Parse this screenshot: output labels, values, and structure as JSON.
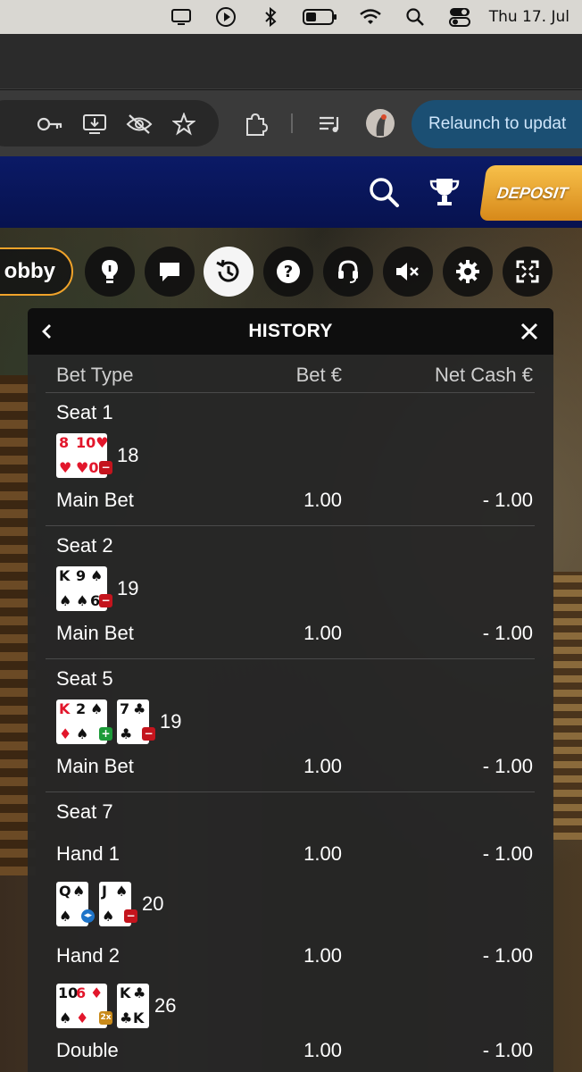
{
  "menubar": {
    "clock": "Thu 17. Jul",
    "icons": [
      "display-icon",
      "play-circle-icon",
      "bluetooth-icon",
      "battery-icon",
      "wifi-icon",
      "spotlight-search-icon",
      "control-center-icon"
    ]
  },
  "browser": {
    "toolbar_icons": [
      "password-key-icon",
      "install-app-icon",
      "eye-off-icon",
      "bookmark-star-icon",
      "extensions-puzzle-icon",
      "media-queue-icon"
    ],
    "relaunch_label": "Relaunch to updat"
  },
  "site": {
    "deposit_label": "DEPOSIT",
    "icons": [
      "search-icon",
      "trophy-icon"
    ]
  },
  "game_controls": {
    "lobby_label": "obby",
    "buttons": [
      "bulb-icon",
      "chat-icon",
      "history-icon",
      "help-icon",
      "support-headset-icon",
      "mute-icon",
      "settings-gear-icon",
      "fullscreen-icon"
    ],
    "active": "history-icon"
  },
  "history": {
    "title": "HISTORY",
    "columns": {
      "bet_type": "Bet Type",
      "bet": "Bet €",
      "net": "Net Cash €"
    },
    "seats": [
      {
        "name": "Seat 1",
        "hands": [
          {
            "cards": [
              {
                "ranks": "8 10",
                "suits": "♥♥",
                "color": "red",
                "wide": true
              }
            ],
            "total": "18",
            "badge": "minus"
          }
        ],
        "bets": [
          {
            "type": "Main Bet",
            "bet": "1.00",
            "net": "- 1.00"
          }
        ]
      },
      {
        "name": "Seat 2",
        "hands": [
          {
            "cards": [
              {
                "ranks": "K 9",
                "suits": "♠♠",
                "color": "black",
                "wide": true
              }
            ],
            "total": "19",
            "badge": "minus"
          }
        ],
        "bets": [
          {
            "type": "Main Bet",
            "bet": "1.00",
            "net": "- 1.00"
          }
        ]
      },
      {
        "name": "Seat 5",
        "hands": [
          {
            "cards": [
              {
                "ranks": "K 2",
                "suits": "♦♠",
                "color": "mixed",
                "wide": true
              },
              {
                "ranks": "7",
                "suits": "♣",
                "color": "black",
                "wide": false
              }
            ],
            "total": "19",
            "badges": [
              "plus",
              "minus"
            ]
          }
        ],
        "bets": [
          {
            "type": "Main Bet",
            "bet": "1.00",
            "net": "- 1.00"
          }
        ]
      },
      {
        "name": "Seat 7",
        "bets": [
          {
            "type": "Hand 1",
            "bet": "1.00",
            "net": "- 1.00"
          },
          {
            "type": "Hand 2",
            "bet": "1.00",
            "net": "- 1.00"
          },
          {
            "type": "Double",
            "bet": "1.00",
            "net": "- 1.00"
          }
        ],
        "hands": [
          {
            "cards": [
              {
                "ranks": "Q",
                "suits": "♠",
                "color": "black",
                "wide": false
              },
              {
                "ranks": "J",
                "suits": "♠",
                "color": "black",
                "wide": false
              }
            ],
            "total": "20",
            "badges": [
              "split",
              "minus"
            ]
          },
          {
            "cards": [
              {
                "ranks": "10 6",
                "suits": "♠♦",
                "color": "mixed",
                "wide": true
              },
              {
                "ranks": "K",
                "suits": "♣",
                "color": "black",
                "wide": false
              }
            ],
            "total": "26",
            "badges": [
              "double"
            ]
          }
        ]
      }
    ],
    "badge_labels": {
      "double": "2x"
    }
  },
  "colors": {
    "site_header": "#0b1a66",
    "deposit": "#f2b33d",
    "relaunch": "#1b4f73",
    "lobby_border": "#f0a32a",
    "loss_badge": "#c4141d",
    "win_badge": "#1e9b3a",
    "split_badge": "#1e74c9"
  }
}
